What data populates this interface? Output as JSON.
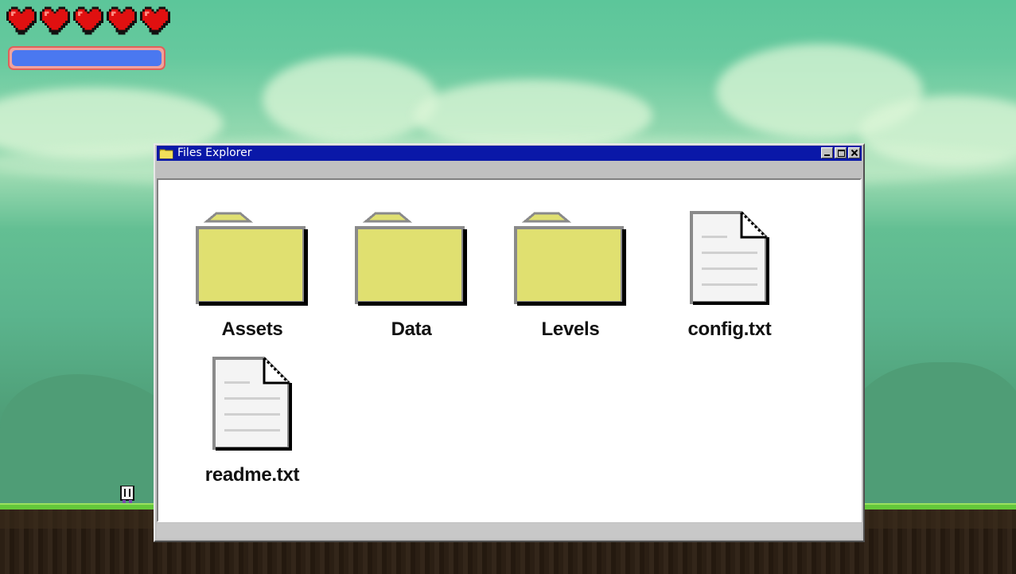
{
  "hud": {
    "hearts": [
      {
        "icon": "heart-icon"
      },
      {
        "icon": "heart-icon"
      },
      {
        "icon": "heart-icon"
      },
      {
        "icon": "heart-icon"
      },
      {
        "icon": "heart-icon"
      }
    ],
    "mana_fraction": 1.0,
    "colors": {
      "heart": "#e01010",
      "mana": "#4a78f0",
      "mana_border": "#e0605a"
    }
  },
  "window": {
    "title": "Files Explorer",
    "title_icon": "folder-icon",
    "controls": [
      "minimize-icon",
      "maximize-icon",
      "close-icon"
    ],
    "colors": {
      "titlebar": "#0a18a8",
      "frame": "#c0c0c0"
    }
  },
  "items": [
    {
      "name": "Assets",
      "type": "folder",
      "icon": "folder-icon"
    },
    {
      "name": "Data",
      "type": "folder",
      "icon": "folder-icon"
    },
    {
      "name": "Levels",
      "type": "folder",
      "icon": "folder-icon"
    },
    {
      "name": "config.txt",
      "type": "file",
      "icon": "text-file-icon"
    },
    {
      "name": "readme.txt",
      "type": "file",
      "icon": "text-file-icon"
    }
  ]
}
